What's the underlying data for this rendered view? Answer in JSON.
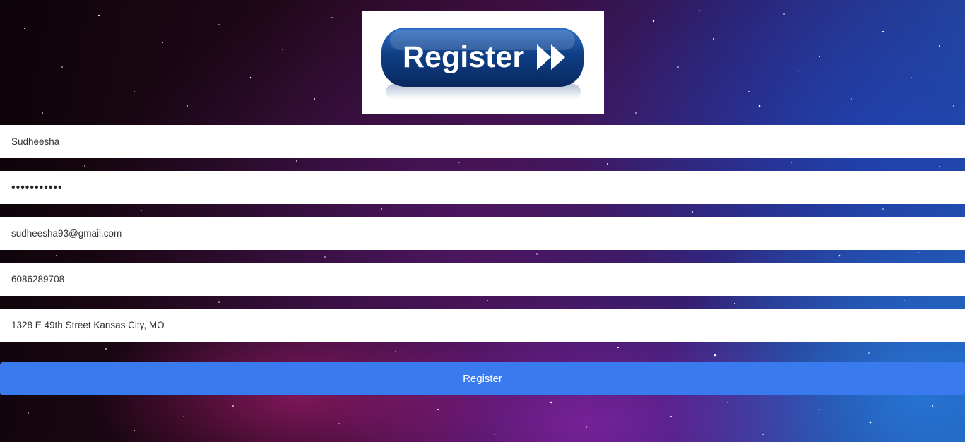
{
  "header": {
    "logo_text": "Register",
    "logo_icon": "double-play-arrow-icon"
  },
  "form": {
    "username": "Sudheesha",
    "password": "•••••••••••",
    "email": "sudheesha93@gmail.com",
    "phone": "6086289708",
    "address": "1328 E 49th Street Kansas City, MO",
    "submit_label": "Register"
  },
  "colors": {
    "button": "#3a7aef",
    "logo_blue": "#0f3f86",
    "field_background": "#ffffff"
  }
}
